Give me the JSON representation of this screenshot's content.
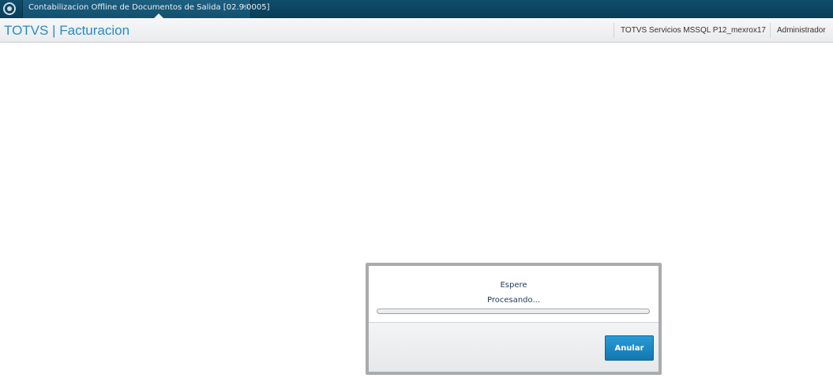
{
  "tab": {
    "title": "Contabilizacion Offline de Documentos de Salida [02.9.0005]",
    "close_glyph": "×",
    "logo_icon": "totvs-logo-icon"
  },
  "header": {
    "brand": "TOTVS | Facturacion",
    "environment": "TOTVS Servicios MSSQL P12_mexrox17",
    "user": "Administrador"
  },
  "dialog": {
    "title": "Espere",
    "message": "Procesando...",
    "cancel_label": "Anular",
    "progress_percent": 0
  },
  "colors": {
    "tabbar": "#0f4d6b",
    "brand": "#2a8ac4",
    "button": "#1a86c2"
  }
}
